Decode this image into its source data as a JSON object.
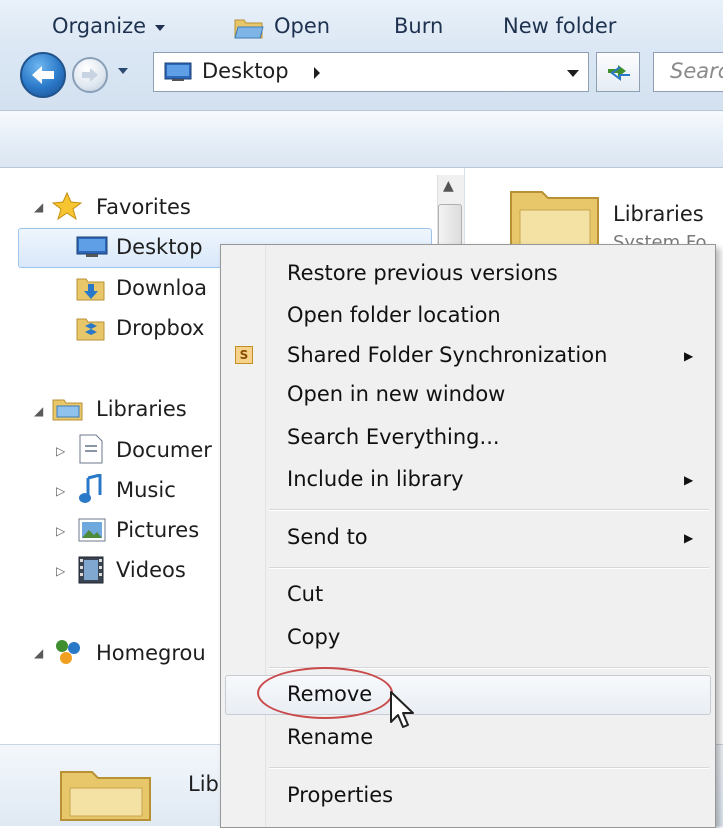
{
  "address": {
    "location": "Desktop",
    "search_placeholder": "Searc"
  },
  "toolbar": {
    "organize": "Organize",
    "open": "Open",
    "burn": "Burn",
    "new_folder": "New folder"
  },
  "nav": {
    "favorites": "Favorites",
    "desktop": "Desktop",
    "downloads": "Downloa",
    "dropbox": "Dropbox",
    "libraries": "Libraries",
    "documents": "Documer",
    "music": "Music",
    "pictures": "Pictures",
    "videos": "Videos",
    "homegroup": "Homegrou"
  },
  "content": {
    "item_label": "Libraries",
    "item_sub": "System Fo"
  },
  "details": {
    "label": "Lib"
  },
  "context_menu": {
    "items": [
      {
        "label": "Restore previous versions"
      },
      {
        "label": "Open folder location"
      },
      {
        "label": "Shared Folder Synchronization",
        "icon": "S"
      },
      {
        "label": "Open in new window"
      },
      {
        "label": "Search Everything..."
      },
      {
        "label": "Include in library"
      },
      {
        "label": "Send to"
      },
      {
        "label": "Cut"
      },
      {
        "label": "Copy"
      },
      {
        "label": "Remove"
      },
      {
        "label": "Rename"
      },
      {
        "label": "Properties"
      }
    ]
  },
  "colors": {
    "highlight_oval": "#c94b4b",
    "accent": "#2a78c8"
  },
  "icons": [
    "back-arrow-icon",
    "forward-arrow-icon",
    "desktop-icon",
    "refresh-icon",
    "star-icon",
    "folder-icon",
    "music-icon",
    "pictures-icon",
    "videos-icon",
    "documents-icon",
    "homegroup-icon",
    "mouse-cursor-icon"
  ]
}
